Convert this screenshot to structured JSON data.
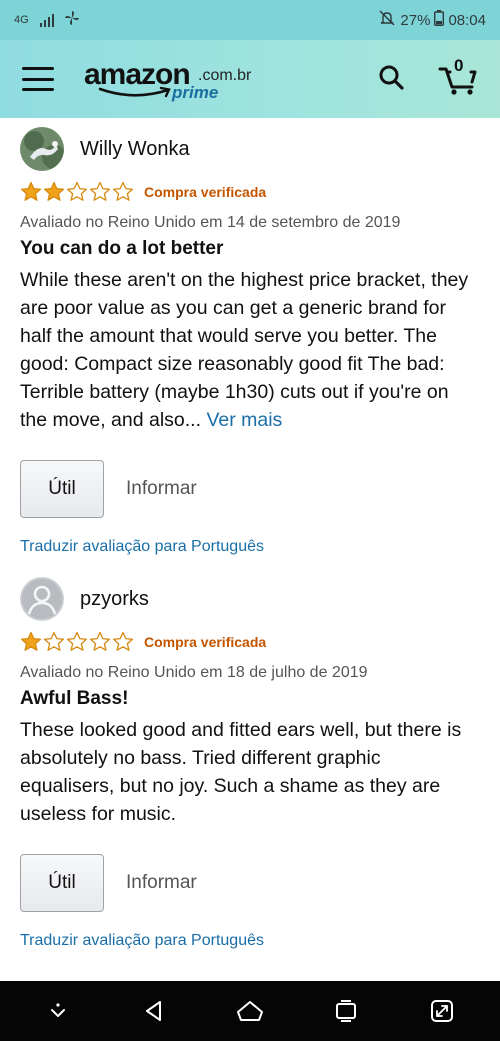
{
  "status_bar": {
    "network": "4G",
    "battery": "27%",
    "time": "08:04"
  },
  "header": {
    "logo_word": "amazon",
    "logo_domain": ".com.br",
    "logo_prime": "prime",
    "cart_count": "0",
    "colors": {
      "bar": "#8fdce0",
      "status": "#7dd3d6"
    }
  },
  "reviews": [
    {
      "reviewer": "Willy Wonka",
      "rating": 2,
      "rating_max": 5,
      "verified": "Compra verificada",
      "meta": "Avaliado no Reino Unido em 14 de setembro de 2019",
      "title": "You can do a lot better",
      "body": "While these aren't on the highest price bracket, they are poor value as you can get a generic brand for half the amount that would serve you better. The good: Compact size reasonably good fit The bad: Terrible battery (maybe 1h30) cuts out if you're on the move, and also...",
      "more": "Ver mais",
      "helpful": "Útil",
      "report": "Informar",
      "translate": "Traduzir avaliação para Português"
    },
    {
      "reviewer": "pzyorks",
      "rating": 1,
      "rating_max": 5,
      "verified": "Compra verificada",
      "meta": "Avaliado no Reino Unido em 18 de julho de 2019",
      "title": "Awful Bass!",
      "body": "These looked good and fitted ears well, but there is absolutely no bass. Tried different graphic equalisers, but no joy. Such a shame as they are useless for music.",
      "helpful": "Útil",
      "report": "Informar",
      "translate": "Traduzir avaliação para Português"
    }
  ],
  "colors": {
    "star_fill": "#f0a21b",
    "star_outline": "#d68a10",
    "verified": "#c45500",
    "link": "#1a6ea8"
  },
  "nav": {
    "icons": [
      "chevron-down-icon",
      "back-icon",
      "home-icon",
      "recents-icon",
      "expand-icon"
    ]
  }
}
